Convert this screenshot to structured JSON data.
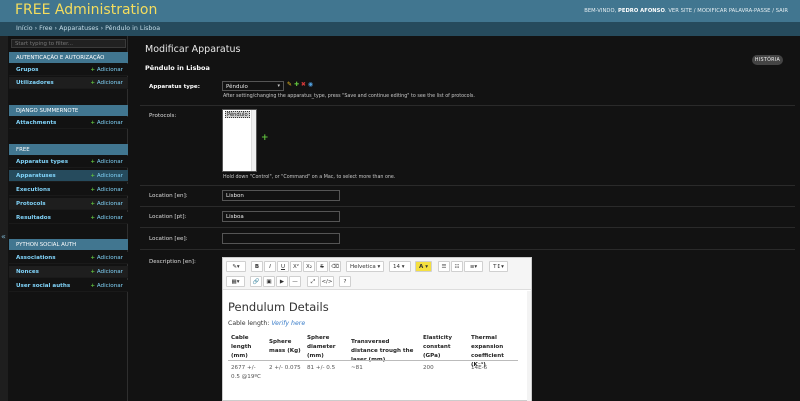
{
  "header": {
    "brand": "FREE Administration",
    "welcome": "BEM-VINDO,",
    "user": "PEDRO AFONSO",
    "view_site": "VER SITE",
    "change_password": "MODIFICAR PALAVRA-PASSE",
    "logout": "SAIR",
    "sep": "/"
  },
  "breadcrumbs": "Início › Free › Apparatuses › Pêndulo in Lisboa",
  "sidebar": {
    "filter_placeholder": "Start typing to filter...",
    "collapse_icon": "«",
    "add_label": "Adicionar",
    "sections": [
      {
        "title": "AUTENTICAÇÃO E AUTORIZAÇÃO",
        "items": [
          "Grupos",
          "Utilizadores"
        ]
      },
      {
        "title": "DJANGO SUMMERNOTE",
        "items": [
          "Attachments"
        ]
      },
      {
        "title": "FREE",
        "items": [
          "Apparatus types",
          "Apparatuses",
          "Executions",
          "Protocols",
          "Resultados"
        ]
      },
      {
        "title": "PYTHON SOCIAL AUTH",
        "items": [
          "Associations",
          "Nonces",
          "User social auths"
        ]
      }
    ]
  },
  "main": {
    "title": "Modificar Apparatus",
    "object_title": "Pêndulo in Lisboa",
    "history_button": "HISTÓRIA",
    "fields": {
      "apparatus_type": {
        "label": "Apparatus type:",
        "value": "Pêndulo",
        "help": "After setting/changing the apparatus_type, press \"Save and continue editing\" to see the list of protocols."
      },
      "protocols": {
        "label": "Protocols:",
        "options": [
          "Pêndulo"
        ],
        "help": "Hold down \"Control\", or \"Command\" on a Mac, to select more than one."
      },
      "location_en": {
        "label": "Location [en]:",
        "value": "Lisbon"
      },
      "location_pt": {
        "label": "Location [pt]:",
        "value": "Lisboa"
      },
      "location_ee": {
        "label": "Location [ee]:",
        "value": ""
      },
      "description_en": {
        "label": "Description [en]:"
      }
    },
    "editor": {
      "toolbar": {
        "magic": "✎▾",
        "bold": "B",
        "italic": "I",
        "underline": "U",
        "superscript": "X²",
        "subscript": "X₂",
        "strikethrough": "S",
        "eraser": "⌫",
        "font_family": "Helvetica",
        "font_size": "14",
        "color": "A",
        "ul": "☰",
        "ol": "☷",
        "align": "≡▾",
        "line_height": "T↕▾",
        "table": "▦▾",
        "link": "🔗",
        "picture": "▣",
        "video": "▶",
        "hr": "—",
        "fullscreen": "⤢",
        "code": "</>",
        "help": "?"
      },
      "heading": "Pendulum Details",
      "cable_prefix": "Cable length: ",
      "cable_link": "Verify here",
      "table": {
        "headers": [
          "Cable length (mm)",
          "Sphere mass (Kg)",
          "Sphere diameter (mm)",
          "Transversed distance trough the laser (mm)",
          "Elasticity constant (GPa)",
          "Thermal expansion coefficient (K⁻¹)"
        ],
        "rows": [
          [
            "2677 +/- 0.5 @19ºC",
            "2 +/- 0.075",
            "81 +/- 0.5",
            "~81",
            "200",
            "14E-6"
          ]
        ]
      }
    }
  },
  "colors": {
    "header_bg": "#417690",
    "brand": "#f5dd5d",
    "breadcrumbs_bg": "#264b5d",
    "link": "#81d4fa",
    "add_plus": "#5fbf3d",
    "page_bg": "#121212"
  }
}
